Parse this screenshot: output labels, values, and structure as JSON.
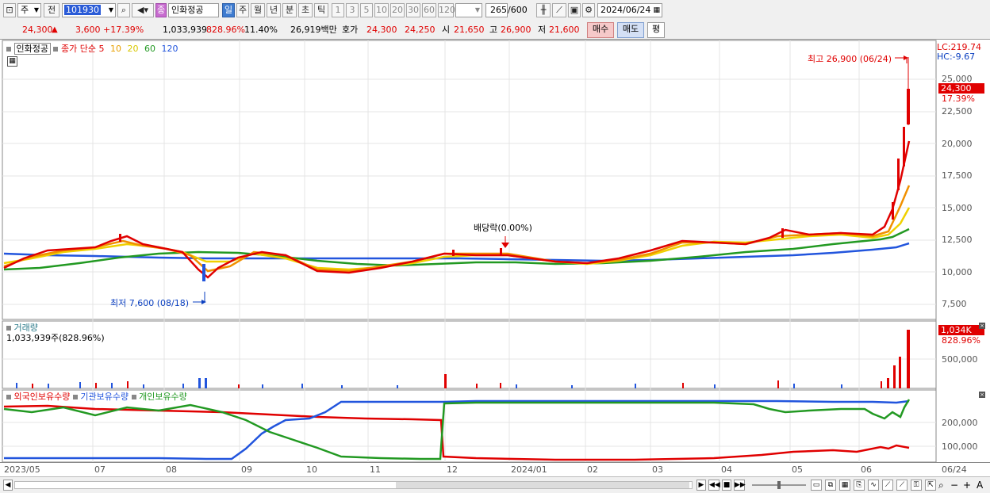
{
  "toolbar": {
    "market_label": "주",
    "prev_label": "전",
    "code": "101930",
    "stock_name": "인화정공",
    "stock_badge": "종",
    "periods": [
      "일",
      "주",
      "월",
      "년",
      "분",
      "초",
      "틱"
    ],
    "minute_steps": [
      "1",
      "3",
      "5",
      "10",
      "20",
      "30",
      "60",
      "120"
    ],
    "count_value": "265",
    "count_total": "/600",
    "date": "2024/06/24"
  },
  "quote": {
    "price": "24,300",
    "arrow": "▲",
    "change": "3,600",
    "change_pct": "+17.39%",
    "volume": "1,033,939",
    "volume_ratio": "828.96%",
    "turnover_pct": "11.40%",
    "amount": "26,919백만",
    "bid_label": "호가",
    "ask": "24,300",
    "bid": "24,250",
    "open_label": "시",
    "open": "21,650",
    "high_label": "고",
    "high": "26,900",
    "low_label": "저",
    "low": "21,600",
    "buy_label": "매수",
    "sell_label": "매도",
    "eval_label": "평"
  },
  "price_panel": {
    "legend_name": "인화정공",
    "legend_ma_label": "종가 단순",
    "ma_periods": [
      "5",
      "10",
      "20",
      "60",
      "120"
    ],
    "ma_colors": [
      "#e00000",
      "#e8a000",
      "#e8d800",
      "#229922",
      "#2255dd"
    ],
    "lc_label": "LC:219.74",
    "hc_label": "HC:-9.67",
    "current_price_tag": "24,300",
    "current_pct_tag": "17.39%",
    "high_annotation": "최고 26,900 (06/24)",
    "low_annotation": "최저 7,600 (08/18)",
    "dividend_annotation": "배당락(0.00%)",
    "y_ticks": [
      "25,000",
      "22,500",
      "20,000",
      "17,500",
      "15,000",
      "12,500",
      "10,000",
      "7,500"
    ]
  },
  "volume_panel": {
    "title": "거래량",
    "value_label": "1,033,939주(828.96%)",
    "tag_value": "1,034K",
    "tag_pct": "828.96%",
    "y_ticks": [
      "500,000"
    ]
  },
  "holdings_panel": {
    "legend": [
      "외국인보유수량",
      "기관보유수량",
      "개인보유수량"
    ],
    "colors": [
      "#e00000",
      "#2255dd",
      "#229922"
    ],
    "y_ticks": [
      "200,000",
      "100,000"
    ]
  },
  "x_axis": {
    "labels": [
      "2023/05",
      "07",
      "08",
      "09",
      "10",
      "11",
      "12",
      "2024/01",
      "02",
      "03",
      "04",
      "05",
      "06"
    ],
    "end_label": "06/24"
  },
  "chart_data": [
    {
      "type": "line",
      "title": "인화정공",
      "x": [
        "2023/05",
        "2023/06",
        "2023/07",
        "2023/08",
        "2023/09",
        "2023/10",
        "2023/11",
        "2023/12",
        "2024/01",
        "2024/02",
        "2024/03",
        "2024/04",
        "2024/05",
        "2024/06",
        "2024/06/24"
      ],
      "ylim": [
        7000,
        27000
      ],
      "series": [
        {
          "name": "종가",
          "values": [
            11000,
            11900,
            12700,
            11200,
            11400,
            10400,
            10400,
            11700,
            11200,
            10900,
            12200,
            12000,
            12900,
            13000,
            24300
          ]
        }
      ]
    },
    {
      "type": "bar",
      "title": "거래량",
      "x": [
        "2023/05",
        "2023/06",
        "2023/07",
        "2023/08",
        "2023/09",
        "2023/10",
        "2023/11",
        "2023/12",
        "2024/01",
        "2024/02",
        "2024/03",
        "2024/04",
        "2024/05",
        "2024/06",
        "2024/06/24"
      ],
      "values": [
        20000,
        30000,
        60000,
        120000,
        25000,
        20000,
        20000,
        200000,
        30000,
        15000,
        25000,
        20000,
        40000,
        600000,
        1033939
      ]
    },
    {
      "type": "line",
      "x": [
        "2023/05",
        "2023/07",
        "2023/08",
        "2023/09",
        "2023/10",
        "2023/11",
        "2023/12",
        "2024/01",
        "2024/02",
        "2024/03",
        "2024/04",
        "2024/05",
        "2024/06",
        "2024/06/24"
      ],
      "ylim": [
        0,
        300000
      ],
      "series": [
        {
          "name": "외국인보유수량",
          "values": [
            270000,
            265000,
            250000,
            245000,
            230000,
            225000,
            20000,
            10000,
            10000,
            12000,
            20000,
            50000,
            80000,
            100000
          ]
        },
        {
          "name": "기관보유수량",
          "values": [
            10000,
            10000,
            10000,
            40000,
            180000,
            290000,
            290000,
            290000,
            290000,
            290000,
            290000,
            290000,
            290000,
            290000
          ]
        },
        {
          "name": "개인보유수량",
          "values": [
            270000,
            260000,
            280000,
            200000,
            30000,
            10000,
            290000,
            290000,
            290000,
            290000,
            290000,
            270000,
            270000,
            290000
          ]
        }
      ]
    }
  ]
}
